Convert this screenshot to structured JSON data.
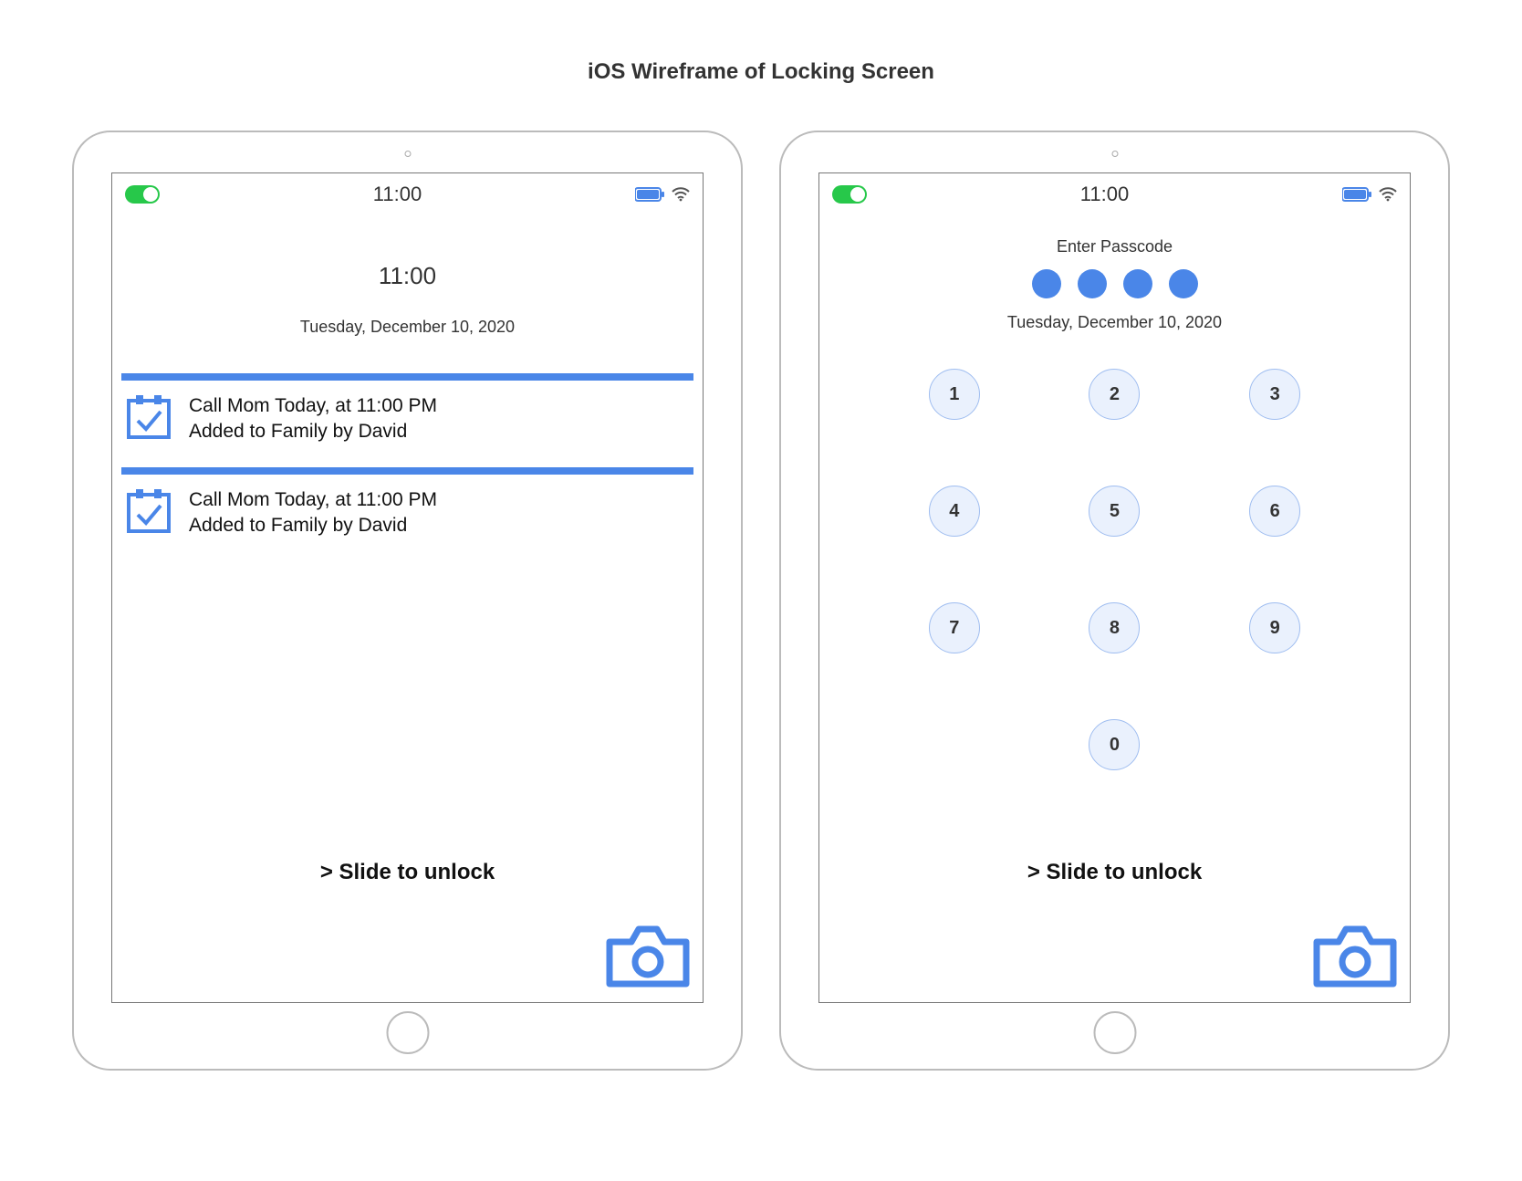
{
  "title": "iOS Wireframe of Locking Screen",
  "status_time": "11:00",
  "lock_screen": {
    "time": "11:00",
    "date": "Tuesday, December 10, 2020",
    "notifications": [
      {
        "line1": "Call Mom Today, at 11:00 PM",
        "line2": "Added to Family by David"
      },
      {
        "line1": "Call Mom Today, at 11:00 PM",
        "line2": "Added to Family by David"
      }
    ],
    "slide_text": "> Slide to unlock"
  },
  "passcode_screen": {
    "label": "Enter Passcode",
    "date": "Tuesday, December 10, 2020",
    "dots_count": 4,
    "keys": [
      "1",
      "2",
      "3",
      "4",
      "5",
      "6",
      "7",
      "8",
      "9",
      "0"
    ],
    "slide_text": "> Slide to unlock"
  }
}
